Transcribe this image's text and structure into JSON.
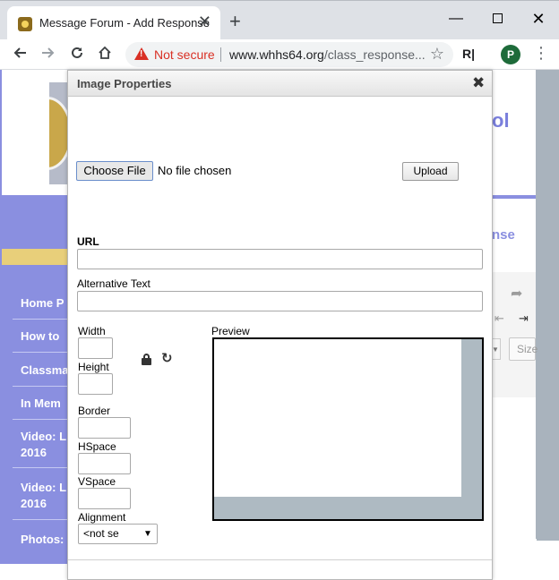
{
  "browser": {
    "tab_title": "Message Forum - Add Response",
    "tab_close": "✕",
    "new_tab": "+",
    "window_min": "—",
    "window_close": "✕",
    "security_label": "Not secure",
    "url_host": "www.whhs64.org",
    "url_path": "/class_response...",
    "extension_label": "R|",
    "profile_initial": "P"
  },
  "page": {
    "title_fragment": "ol",
    "subtitle_fragment": "nse",
    "nav_items": [
      "Home P",
      "How to",
      "Classma",
      "In Mem",
      "Video: L",
      "2016",
      "Video: L",
      "2016",
      "Photos:"
    ],
    "editor_size_label": "Size"
  },
  "dialog": {
    "title": "Image Properties",
    "close_glyph": "✖",
    "choose_file_label": "Choose File",
    "file_status": "No file chosen",
    "upload_label": "Upload",
    "url_label": "URL",
    "url_value": "",
    "alt_label": "Alternative Text",
    "alt_value": "",
    "width_label": "Width",
    "height_label": "Height",
    "border_label": "Border",
    "hspace_label": "HSpace",
    "vspace_label": "VSpace",
    "alignment_label": "Alignment",
    "alignment_value": "<not se",
    "preview_label": "Preview"
  }
}
